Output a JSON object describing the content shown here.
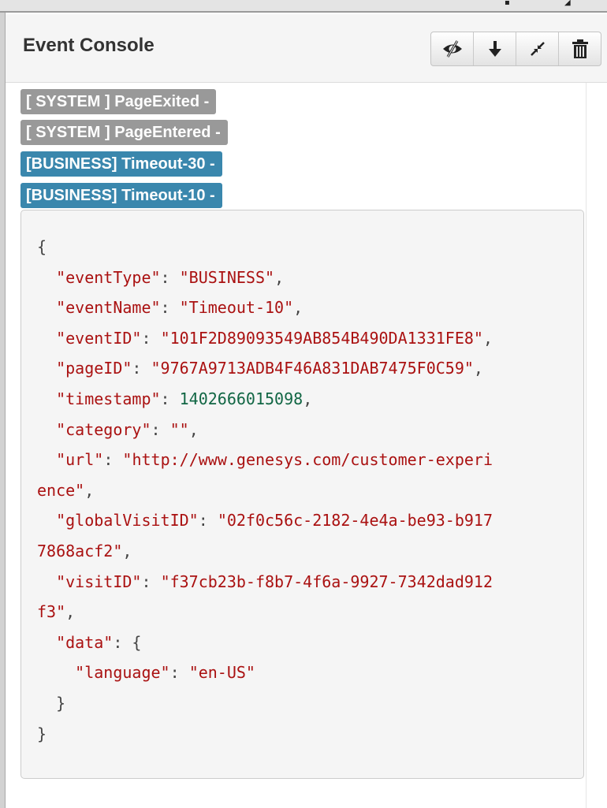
{
  "panel": {
    "title": "Event Console",
    "toolbar": [
      {
        "name": "toggle-visibility-icon"
      },
      {
        "name": "download-icon"
      },
      {
        "name": "collapse-icon"
      },
      {
        "name": "trash-icon"
      }
    ]
  },
  "events": [
    {
      "type_tag": "[ SYSTEM ]",
      "name": "PageExited",
      "toggle": "-",
      "kind": "system"
    },
    {
      "type_tag": "[ SYSTEM ]",
      "name": "PageEntered",
      "toggle": "-",
      "kind": "system"
    },
    {
      "type_tag": "[BUSINESS]",
      "name": "Timeout-30",
      "toggle": "-",
      "kind": "business"
    },
    {
      "type_tag": "[BUSINESS]",
      "name": "Timeout-10",
      "toggle": "-",
      "kind": "business"
    }
  ],
  "expanded_event": {
    "json_lines": [
      [
        {
          "t": "p",
          "v": "{"
        }
      ],
      [
        {
          "t": "p",
          "v": "  "
        },
        {
          "t": "k",
          "v": "\"eventType\""
        },
        {
          "t": "p",
          "v": ": "
        },
        {
          "t": "s",
          "v": "\"BUSINESS\""
        },
        {
          "t": "p",
          "v": ","
        }
      ],
      [
        {
          "t": "p",
          "v": "  "
        },
        {
          "t": "k",
          "v": "\"eventName\""
        },
        {
          "t": "p",
          "v": ": "
        },
        {
          "t": "s",
          "v": "\"Timeout-10\""
        },
        {
          "t": "p",
          "v": ","
        }
      ],
      [
        {
          "t": "p",
          "v": "  "
        },
        {
          "t": "k",
          "v": "\"eventID\""
        },
        {
          "t": "p",
          "v": ": "
        },
        {
          "t": "s",
          "v": "\"101F2D89093549AB854B490DA1331FE8\""
        },
        {
          "t": "p",
          "v": ","
        }
      ],
      [
        {
          "t": "p",
          "v": "  "
        },
        {
          "t": "k",
          "v": "\"pageID\""
        },
        {
          "t": "p",
          "v": ": "
        },
        {
          "t": "s",
          "v": "\"9767A9713ADB4F46A831DAB7475F0C59\""
        },
        {
          "t": "p",
          "v": ","
        }
      ],
      [
        {
          "t": "p",
          "v": "  "
        },
        {
          "t": "k",
          "v": "\"timestamp\""
        },
        {
          "t": "p",
          "v": ": "
        },
        {
          "t": "n",
          "v": "1402666015098"
        },
        {
          "t": "p",
          "v": ","
        }
      ],
      [
        {
          "t": "p",
          "v": "  "
        },
        {
          "t": "k",
          "v": "\"category\""
        },
        {
          "t": "p",
          "v": ": "
        },
        {
          "t": "s",
          "v": "\"\""
        },
        {
          "t": "p",
          "v": ","
        }
      ],
      [
        {
          "t": "p",
          "v": "  "
        },
        {
          "t": "k",
          "v": "\"url\""
        },
        {
          "t": "p",
          "v": ": "
        },
        {
          "t": "s",
          "v": "\"http://www.genesys.com/customer-experi"
        }
      ],
      [
        {
          "t": "s",
          "v": "ence\""
        },
        {
          "t": "p",
          "v": ","
        }
      ],
      [
        {
          "t": "p",
          "v": "  "
        },
        {
          "t": "k",
          "v": "\"globalVisitID\""
        },
        {
          "t": "p",
          "v": ": "
        },
        {
          "t": "s",
          "v": "\"02f0c56c-2182-4e4a-be93-b917"
        }
      ],
      [
        {
          "t": "s",
          "v": "7868acf2\""
        },
        {
          "t": "p",
          "v": ","
        }
      ],
      [
        {
          "t": "p",
          "v": "  "
        },
        {
          "t": "k",
          "v": "\"visitID\""
        },
        {
          "t": "p",
          "v": ": "
        },
        {
          "t": "s",
          "v": "\"f37cb23b-f8b7-4f6a-9927-7342dad912"
        }
      ],
      [
        {
          "t": "s",
          "v": "f3\""
        },
        {
          "t": "p",
          "v": ","
        }
      ],
      [
        {
          "t": "p",
          "v": "  "
        },
        {
          "t": "k",
          "v": "\"data\""
        },
        {
          "t": "p",
          "v": ": {"
        }
      ],
      [
        {
          "t": "p",
          "v": "    "
        },
        {
          "t": "k",
          "v": "\"language\""
        },
        {
          "t": "p",
          "v": ": "
        },
        {
          "t": "s",
          "v": "\"en-US\""
        }
      ],
      [
        {
          "t": "p",
          "v": "  }"
        }
      ],
      [
        {
          "t": "p",
          "v": "}"
        }
      ]
    ]
  }
}
